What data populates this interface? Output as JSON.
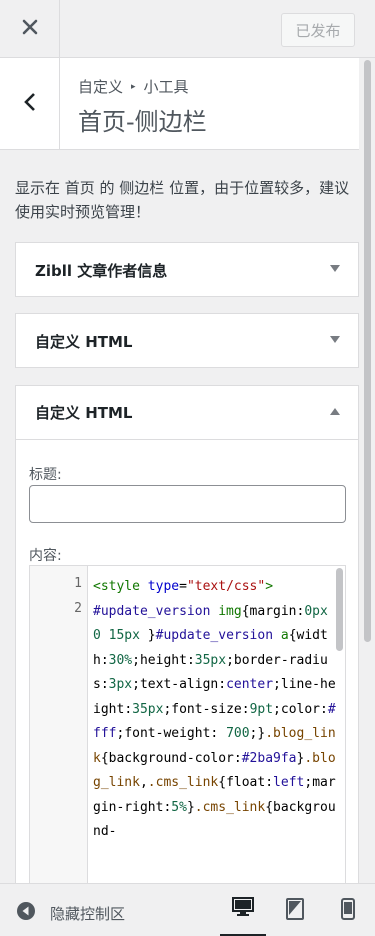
{
  "header": {
    "close_icon": "close-icon",
    "publish_label": "已发布"
  },
  "section": {
    "back_icon": "chevron-left-icon",
    "breadcrumb_parent": "自定义",
    "breadcrumb_sep": "▸",
    "breadcrumb_current": "小工具",
    "title": "首页-侧边栏"
  },
  "description": "显示在 首页 的 侧边栏 位置，由于位置较多，建议使用实时预览管理！",
  "widgets": [
    {
      "title": "Zibll 文章作者信息",
      "state": "collapsed"
    },
    {
      "title": "自定义 HTML",
      "state": "collapsed"
    },
    {
      "title": "自定义 HTML",
      "state": "expanded"
    }
  ],
  "form": {
    "title_label": "标题:",
    "title_value": "",
    "content_label": "内容:"
  },
  "editor": {
    "line_numbers": [
      "1",
      "2"
    ]
  },
  "footer": {
    "hide_label": "隐藏控制区",
    "devices": [
      "desktop",
      "tablet",
      "mobile"
    ],
    "active_device": "desktop"
  }
}
